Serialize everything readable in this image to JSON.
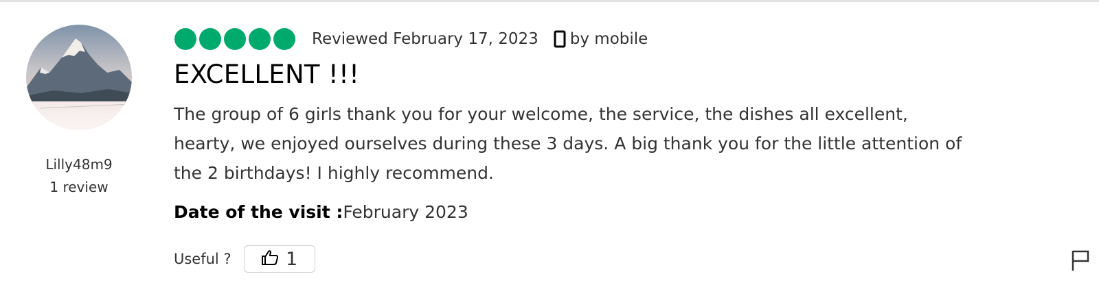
{
  "reviewer": {
    "name": "Lilly48m9",
    "review_count": "1 review"
  },
  "rating": {
    "bubbles_filled": 5,
    "bubbles_total": 5,
    "color": "#00aa6c"
  },
  "meta": {
    "reviewed_date": "Reviewed February 17, 2023",
    "via": "by mobile"
  },
  "review": {
    "title": "EXCELLENT !!!",
    "body_lines": [
      "The group of 6 girls thank you for your welcome, the service, the dishes all excellent,",
      "hearty, we enjoyed ourselves during these 3 days. A big thank you for the little attention of",
      "the 2 birthdays! I highly recommend."
    ]
  },
  "visit": {
    "label": "Date of the visit :",
    "value": "February 2023"
  },
  "helpful": {
    "label": "Useful ?",
    "count": "1"
  },
  "icons": {
    "device": "mobile-phone-icon",
    "thumbs": "thumbs-up-icon",
    "report": "flag-icon"
  }
}
